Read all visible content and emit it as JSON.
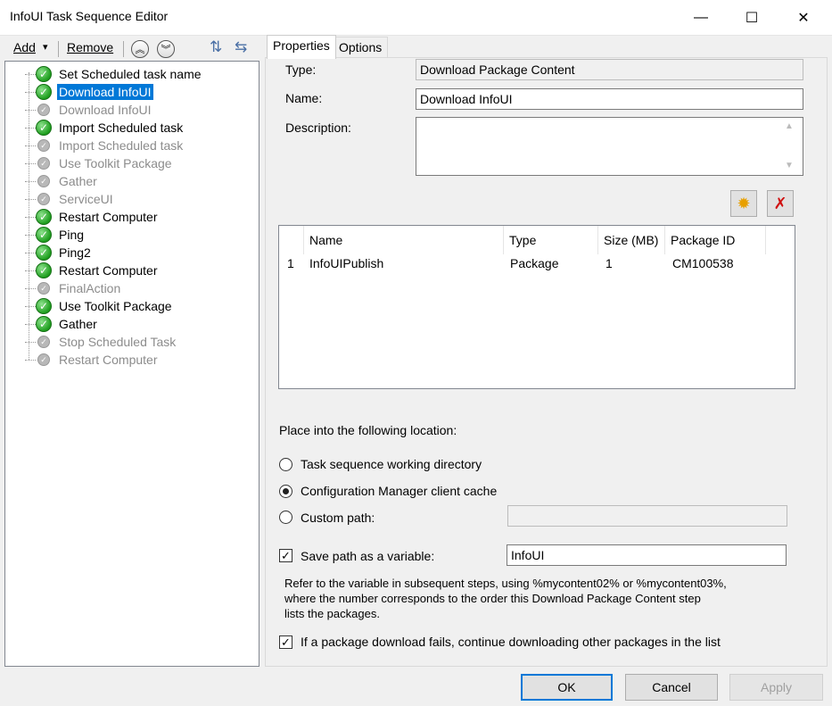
{
  "window": {
    "title": "InfoUI Task Sequence Editor",
    "minimize_glyph": "—",
    "maximize_glyph": "☐",
    "close_glyph": "✕"
  },
  "toolbar": {
    "add_label": "Add",
    "add_dropdown_glyph": "▾",
    "remove_label": "Remove",
    "move_up_glyph": "︽",
    "move_down_glyph": "︾",
    "icon_a_glyph": "⇅",
    "icon_b_glyph": "⇆"
  },
  "tree": {
    "items": [
      {
        "label": "Set Scheduled task name",
        "enabled": true,
        "selected": false
      },
      {
        "label": "Download InfoUI",
        "enabled": true,
        "selected": true
      },
      {
        "label": "Download InfoUI",
        "enabled": false,
        "selected": false
      },
      {
        "label": "Import Scheduled task",
        "enabled": true,
        "selected": false
      },
      {
        "label": "Import Scheduled task",
        "enabled": false,
        "selected": false
      },
      {
        "label": "Use Toolkit Package",
        "enabled": false,
        "selected": false
      },
      {
        "label": "Gather",
        "enabled": false,
        "selected": false
      },
      {
        "label": "ServiceUI",
        "enabled": false,
        "selected": false
      },
      {
        "label": "Restart Computer",
        "enabled": true,
        "selected": false
      },
      {
        "label": "Ping",
        "enabled": true,
        "selected": false
      },
      {
        "label": "Ping2",
        "enabled": true,
        "selected": false
      },
      {
        "label": "Restart Computer",
        "enabled": true,
        "selected": false
      },
      {
        "label": "FinalAction",
        "enabled": false,
        "selected": false
      },
      {
        "label": "Use Toolkit Package",
        "enabled": true,
        "selected": false
      },
      {
        "label": "Gather",
        "enabled": true,
        "selected": false
      },
      {
        "label": "Stop Scheduled Task",
        "enabled": false,
        "selected": false
      },
      {
        "label": "Restart Computer",
        "enabled": false,
        "selected": false
      }
    ]
  },
  "tabs": [
    {
      "label": "Properties",
      "active": true
    },
    {
      "label": "Options",
      "active": false
    }
  ],
  "properties": {
    "type_label": "Type:",
    "type_value": "Download Package Content",
    "name_label": "Name:",
    "name_value": "Download InfoUI",
    "description_label": "Description:",
    "description_value": "",
    "add_package_glyph": "✹",
    "delete_package_glyph": "✗"
  },
  "package_list": {
    "columns": [
      "",
      "Name",
      "Type",
      "Size (MB)",
      "Package ID"
    ],
    "rows": [
      {
        "index": "1",
        "name": "InfoUIPublish",
        "type": "Package",
        "size": "1",
        "package_id": "CM100538"
      }
    ]
  },
  "location": {
    "heading": "Place into the following location:",
    "options": [
      {
        "label": "Task sequence working directory",
        "selected": false
      },
      {
        "label": "Configuration Manager client cache",
        "selected": true
      },
      {
        "label": "Custom path:",
        "selected": false
      }
    ],
    "custom_path_value": ""
  },
  "save_path": {
    "label": "Save path as a variable:",
    "checked": true,
    "value": "InfoUI",
    "help_line1": "Refer to the variable in subsequent steps, using %mycontent02% or %mycontent03%,",
    "help_line2": "where the number corresponds to the order this Download Package Content step",
    "help_line3": "lists the packages."
  },
  "continue_on_fail": {
    "label": "If a package download fails, continue downloading other packages in the list",
    "checked": true
  },
  "buttons": {
    "ok": "OK",
    "cancel": "Cancel",
    "apply": "Apply"
  }
}
